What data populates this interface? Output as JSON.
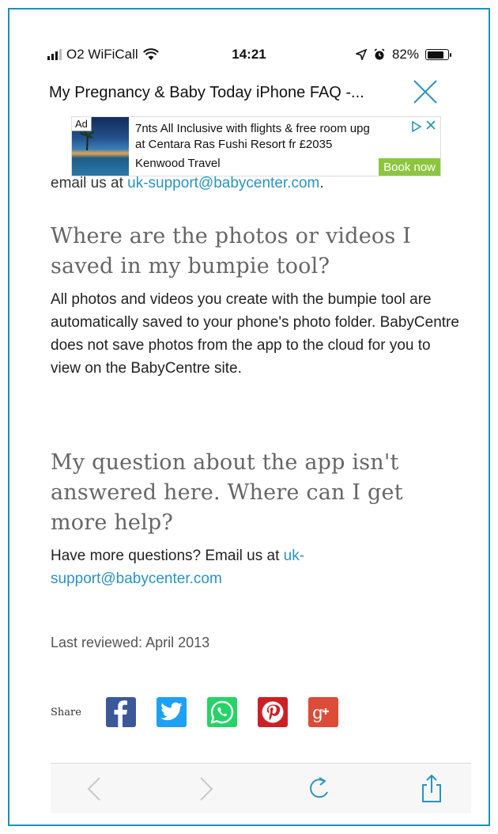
{
  "status_bar": {
    "carrier": "O2 WiFiCall",
    "time": "14:21",
    "battery": "82%",
    "battery_level": 0.82
  },
  "header": {
    "title": "My Pregnancy & Baby Today iPhone FAQ -..."
  },
  "ad": {
    "label": "Ad",
    "line1": "7nts All Inclusive with flights & free room upg",
    "line2": "at Centara Ras Fushi Resort fr £2035",
    "advertiser": "Kenwood Travel",
    "cta": "Book now"
  },
  "content": {
    "partial_prefix": "email us at ",
    "partial_link": "uk-support@babycenter.com",
    "partial_suffix": ".",
    "q1_heading": "Where are the photos or videos I saved in my bumpie tool?",
    "q1_answer": "All photos and videos you create with the bumpie tool are automatically saved to your phone's photo folder. BabyCentre does not save photos from the app to the cloud for you to view on the BabyCentre site.",
    "q2_heading": "My question about the app isn't answered here. Where can I get more help?",
    "q2_answer_prefix": "Have more questions? Email us at ",
    "q2_answer_link": "uk-support@babycenter.com",
    "last_reviewed": "Last reviewed: April 2013"
  },
  "share": {
    "label": "Share",
    "buttons": [
      {
        "name": "facebook",
        "color": "#3b5998"
      },
      {
        "name": "twitter",
        "color": "#1da1f2"
      },
      {
        "name": "whatsapp",
        "color": "#25d366"
      },
      {
        "name": "pinterest",
        "color": "#cb2027"
      },
      {
        "name": "google-plus",
        "color": "#dd4b39"
      }
    ]
  },
  "colors": {
    "link": "#2a93c0",
    "frame_border": "#1e8fc2",
    "ad_cta": "#8cc63f"
  }
}
